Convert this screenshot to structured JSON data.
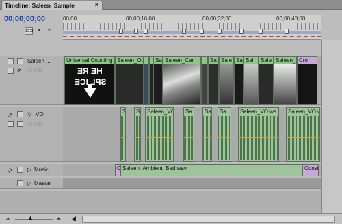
{
  "window": {
    "tab_title": "Timeline: Saleen_Sample",
    "close_glyph": "×"
  },
  "timecode": "00;00;00;00",
  "ruler": {
    "labels": [
      "00;00",
      "00;00;16;00",
      "00;00;32;00",
      "00;00;48;00"
    ],
    "marker_count": 13
  },
  "tracks": {
    "video": {
      "name": "Saleen ...",
      "clips": [
        "Universal Counting",
        "Saleen_Op",
        "",
        "",
        "Sa",
        "Saleen_Car",
        "",
        "Sa",
        "Sale",
        "Sa",
        "Sal",
        "Sale",
        "Saleen_",
        "Cro"
      ],
      "overlay_text": [
        "HE RE",
        "SPL ICE"
      ]
    },
    "vo": {
      "name": "VO",
      "clips": [
        "S",
        "S",
        "Saleen_VC",
        "Sa",
        "Sa",
        "Sa",
        "Saleen_VO.wa",
        "Saleen_VO.wa"
      ]
    },
    "music": {
      "name": "Music",
      "clips": [
        "C",
        "Saleen_Ambient_Bed.wav",
        "Const"
      ]
    },
    "master": {
      "name": "Master"
    }
  },
  "icons": {
    "video_eye": "eye-icon",
    "speaker": "speaker-icon",
    "lock": "lock-icon",
    "expand": "triangle-expand-icon"
  },
  "colors": {
    "timecode": "#1f3fb0",
    "playhead": "#e0542b",
    "clip_green": "#8fc48a",
    "ruler_bar": "#9ea8c6"
  }
}
